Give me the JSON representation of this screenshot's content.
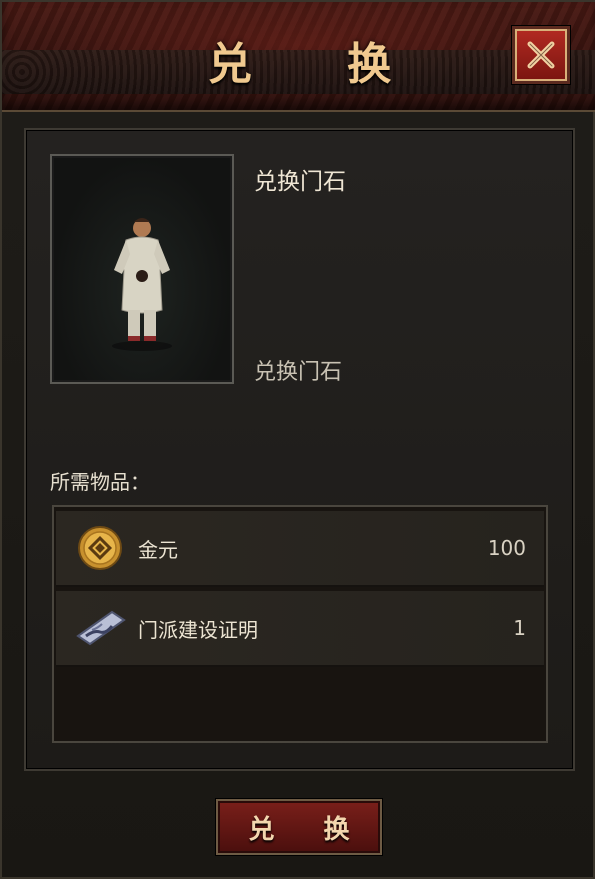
{
  "dialog": {
    "title": "兑 换",
    "close_icon": "close-icon"
  },
  "item": {
    "name": "兑换门石",
    "description": "兑换门石",
    "portrait_icon": "character-robe-figure"
  },
  "requirements": {
    "label": "所需物品：",
    "items": [
      {
        "name": "金元",
        "quantity": "100",
        "icon": "gold-coin-icon"
      },
      {
        "name": "门派建设证明",
        "quantity": "1",
        "icon": "scroll-token-icon"
      }
    ]
  },
  "actions": {
    "exchange_label": "兑 换"
  },
  "colors": {
    "title_gold": "#f0c98f",
    "button_red": "#7a1f1a",
    "close_red": "#b32a22"
  }
}
